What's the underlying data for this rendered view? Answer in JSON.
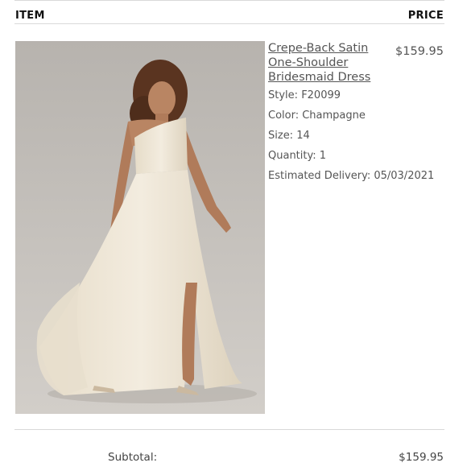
{
  "table": {
    "item_header": "ITEM",
    "price_header": "PRICE"
  },
  "product": {
    "title": "Crepe-Back Satin One-Shoulder Bridesmaid Dress",
    "price": "$159.95",
    "style_label": "Style:",
    "style_value": "F20099",
    "color_label": "Color:",
    "color_value": "Champagne",
    "size_label": "Size:",
    "size_value": "14",
    "quantity_label": "Quantity:",
    "quantity_value": "1",
    "delivery_label": "Estimated Delivery:",
    "delivery_value": "05/03/2021",
    "image_alt": "Model wearing champagne one-shoulder bridesmaid dress"
  },
  "summary": {
    "subtotal_label": "Subtotal:",
    "subtotal_value": "$159.95"
  },
  "colors": {
    "photo_background": "#c2beb9",
    "dress": "#efe7d7",
    "skin": "#b98563",
    "hair": "#5a3420"
  }
}
